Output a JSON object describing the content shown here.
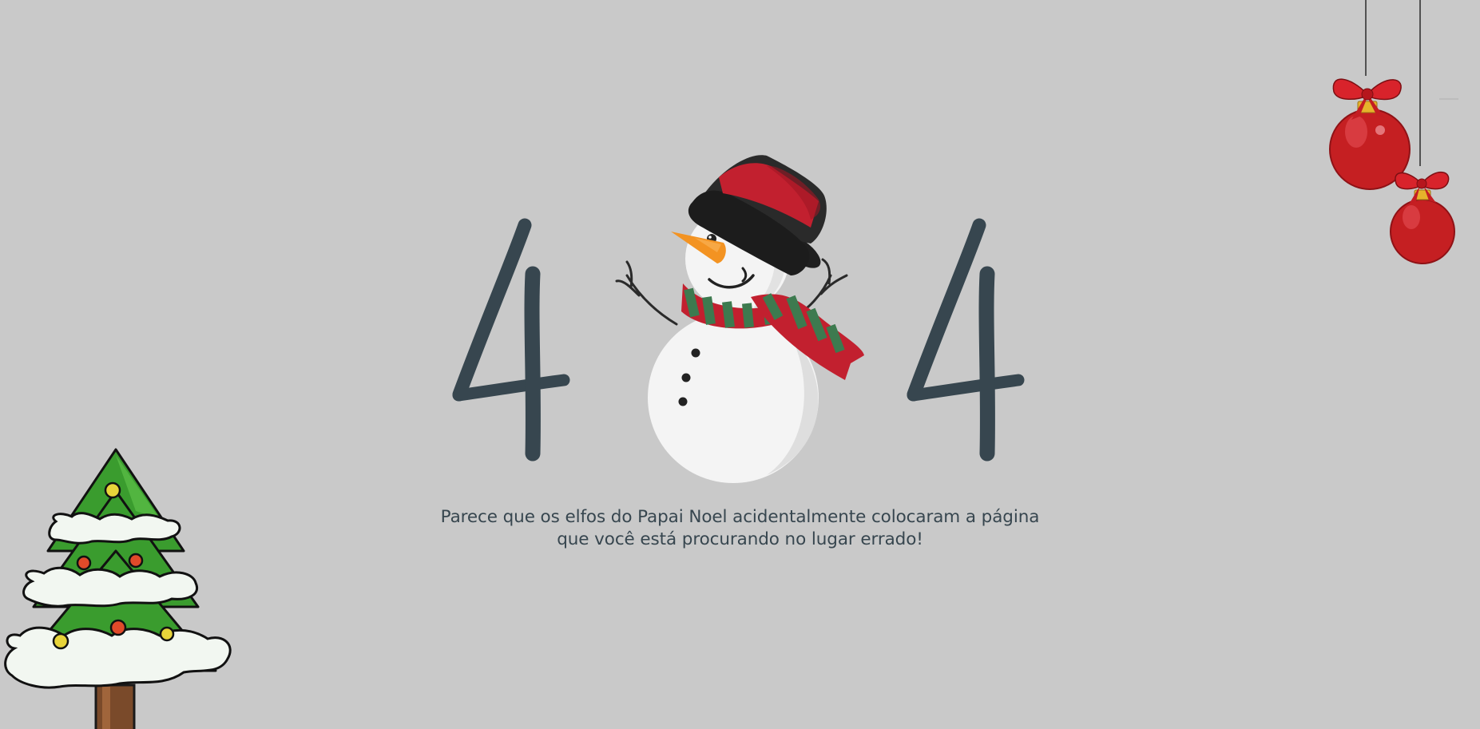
{
  "error": {
    "code_digits": [
      "4",
      "4"
    ]
  },
  "message": {
    "line1": "Parece que os elfos do Papai Noel acidentalmente colocaram a página",
    "line2": "que você está procurando no lugar errado!"
  },
  "icons": {
    "center": "snowman-icon",
    "corner_top_right": "christmas-ornaments-icon",
    "corner_bottom_left": "christmas-tree-icon"
  },
  "colors": {
    "background": "#c9c9c9",
    "digit": "#37464f",
    "text": "#37464f",
    "accent_red": "#c2202f",
    "accent_green": "#3d7a4f"
  }
}
